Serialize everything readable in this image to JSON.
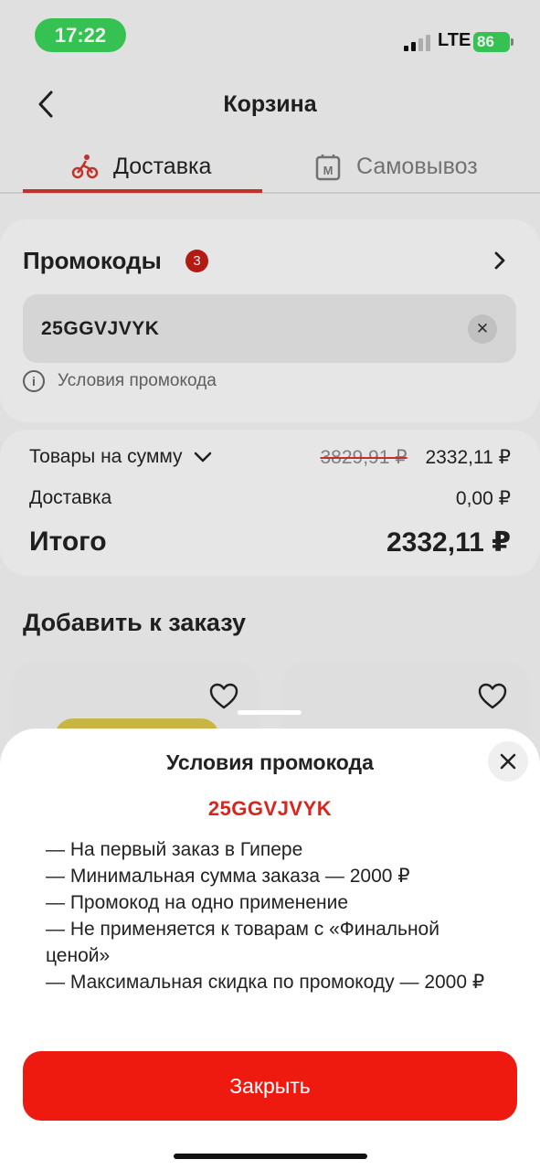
{
  "status": {
    "time": "17:22",
    "network": "LTE",
    "battery": "86"
  },
  "header": {
    "title": "Корзина"
  },
  "tabs": [
    {
      "label": "Доставка",
      "active": true
    },
    {
      "label": "Самовывоз",
      "active": false
    }
  ],
  "promo": {
    "title": "Промокоды",
    "count": "3",
    "code_value": "25GGVJVYK",
    "conditions_link": "Условия промокода"
  },
  "summary": {
    "goods_label": "Товары на сумму",
    "goods_old": "3829,91 ₽",
    "goods_new": "2332,11 ₽",
    "delivery_label": "Доставка",
    "delivery_value": "0,00 ₽",
    "total_label": "Итого",
    "total_value": "2332,11 ₽"
  },
  "add_section": {
    "title": "Добавить к заказу"
  },
  "sheet": {
    "title": "Условия промокода",
    "code": "25GGVJVYK",
    "conditions": [
      "— На первый заказ в Гипере",
      "— Минимальная сумма заказа — 2000 ₽",
      "— Промокод на одно применение",
      "— Не применяется к товарам с «Финальной ценой»",
      "— Максимальная скидка по промокоду — 2000 ₽"
    ],
    "close_button": "Закрыть"
  },
  "colors": {
    "accent": "#ee1a10",
    "code_red": "#d8251d",
    "status_green": "#3ad15a"
  }
}
